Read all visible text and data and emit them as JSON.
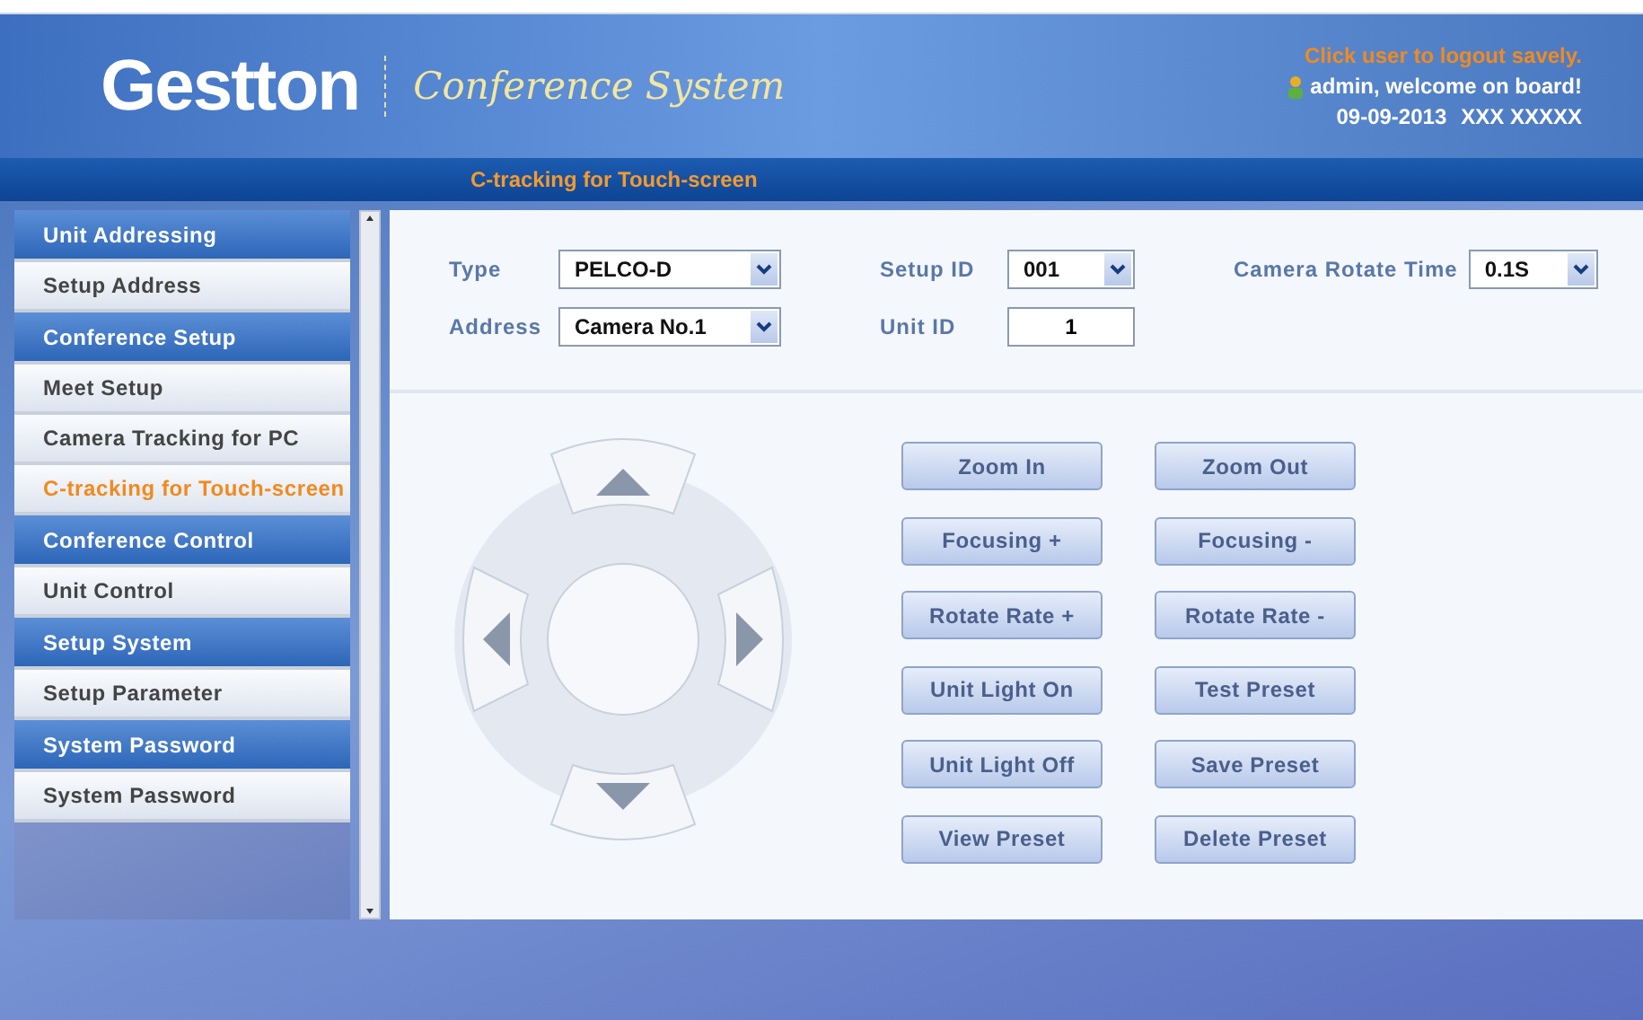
{
  "header": {
    "logo": "Gestton",
    "subtitle": "Conference System",
    "logout_hint": "Click user to logout savely.",
    "welcome": "admin, welcome on board!",
    "date": "09-09-2013",
    "date_extra": "XXX  XXXXX"
  },
  "breadcrumb": "C-tracking for Touch-screen",
  "sidebar": {
    "items": [
      {
        "kind": "header",
        "label": "Unit Addressing",
        "selected": false
      },
      {
        "kind": "item",
        "label": "Setup Address",
        "selected": false
      },
      {
        "kind": "header",
        "label": "Conference Setup",
        "selected": false
      },
      {
        "kind": "item",
        "label": "Meet Setup",
        "selected": false
      },
      {
        "kind": "item",
        "label": "Camera Tracking for PC",
        "selected": false
      },
      {
        "kind": "item",
        "label": "C-tracking for Touch-screen",
        "selected": true
      },
      {
        "kind": "header",
        "label": "Conference Control",
        "selected": false
      },
      {
        "kind": "item",
        "label": "Unit Control",
        "selected": false
      },
      {
        "kind": "header",
        "label": "Setup System",
        "selected": false
      },
      {
        "kind": "item",
        "label": "Setup Parameter",
        "selected": false
      },
      {
        "kind": "header",
        "label": "System Password",
        "selected": false
      },
      {
        "kind": "item",
        "label": "System Password",
        "selected": false
      }
    ]
  },
  "form": {
    "rows": [
      [
        {
          "label": "Type",
          "kind": "select",
          "value": "PELCO-D"
        },
        {
          "label": "Setup ID",
          "kind": "select",
          "value": "001"
        },
        {
          "label": "Camera Rotate Time",
          "kind": "select",
          "value": "0.1S"
        }
      ],
      [
        {
          "label": "Address",
          "kind": "select",
          "value": "Camera No.1"
        },
        {
          "label": "Unit ID",
          "kind": "input",
          "value": "1"
        }
      ]
    ]
  },
  "buttons": [
    [
      "Zoom In",
      "Zoom Out"
    ],
    [
      "Focusing +",
      "Focusing -"
    ],
    [
      "Rotate Rate +",
      "Rotate Rate -"
    ],
    [
      "Unit Light On",
      "Test Preset"
    ],
    [
      "Unit Light Off",
      "Save Preset"
    ],
    [
      "View Preset",
      "Delete Preset"
    ]
  ]
}
